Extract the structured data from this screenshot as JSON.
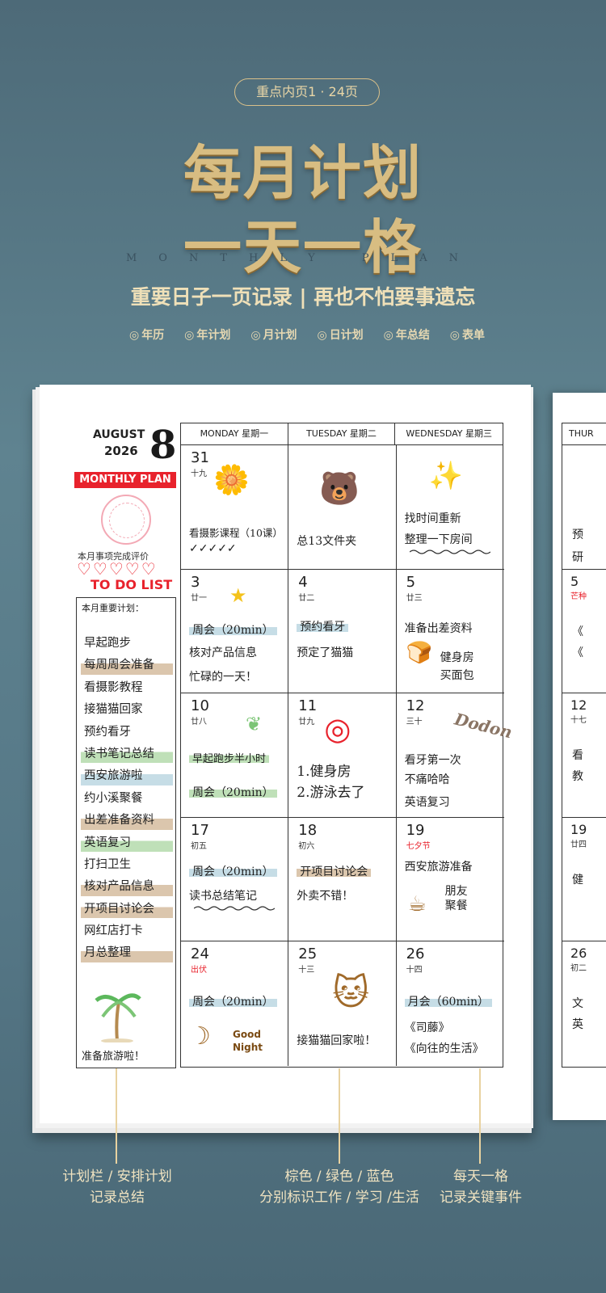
{
  "header": {
    "badge": "重点内页1 · 24页",
    "title_line1": "每月计划",
    "title_line2": "一天一格",
    "subtitle_en": "MONTHLY PLAN",
    "tagline": "重要日子一页记录 | 再也不怕要事遗忘",
    "features": [
      "年历",
      "年计划",
      "月计划",
      "日计划",
      "年总结",
      "表单"
    ]
  },
  "colors": {
    "accent_red": "#e8222c",
    "gold": "#d8bd82",
    "brown_highlight": "#dbc6ad",
    "green_highlight": "#bfe0b8",
    "blue_highlight": "#c6dde6"
  },
  "sidebar": {
    "month_name": "AUGUST",
    "year": "2026",
    "month_number": "8",
    "monthly_plan": "MONTHLY PLAN",
    "eval_label": "本月事项完成评价",
    "hearts": "♡♡♡♡♡",
    "todo": "TO DO LIST",
    "plan_title": "本月重要计划：",
    "plan_items": [
      {
        "text": "早起跑步",
        "hl": ""
      },
      {
        "text": "每周周会准备",
        "hl": "brown"
      },
      {
        "text": "看摄影教程",
        "hl": ""
      },
      {
        "text": "接猫猫回家",
        "hl": ""
      },
      {
        "text": "预约看牙",
        "hl": ""
      },
      {
        "text": "读书笔记总结",
        "hl": "green"
      },
      {
        "text": "西安旅游啦",
        "hl": "blue"
      },
      {
        "text": "约小溪聚餐",
        "hl": ""
      },
      {
        "text": "出差准备资料",
        "hl": "brown"
      },
      {
        "text": "英语复习",
        "hl": "green"
      },
      {
        "text": "打扫卫生",
        "hl": ""
      },
      {
        "text": "核对产品信息",
        "hl": "brown"
      },
      {
        "text": "开项目讨论会",
        "hl": "brown"
      },
      {
        "text": "网红店打卡",
        "hl": ""
      },
      {
        "text": "月总整理",
        "hl": "brown"
      }
    ],
    "plan_footer": "准备旅游啦！"
  },
  "calendar": {
    "headers": [
      "MONDAY  星期一",
      "TUESDAY  星期二",
      "WEDNESDAY  星期三"
    ],
    "rows": [
      [
        {
          "day": "31",
          "lunar": "十九",
          "notes": [
            "看摄影课程（10课）",
            "✓✓✓✓✓"
          ]
        },
        {
          "day": "",
          "lunar": "",
          "notes": [
            "总13文件夹"
          ]
        },
        {
          "day": "",
          "lunar": "",
          "notes": [
            "找时间重新",
            "整理一下房间"
          ]
        }
      ],
      [
        {
          "day": "3",
          "lunar": "廿一",
          "notes": [
            "周会（20min）",
            "核对产品信息",
            "忙碌的一天！"
          ]
        },
        {
          "day": "4",
          "lunar": "廿二",
          "notes": [
            "预约看牙",
            "预定了猫猫"
          ]
        },
        {
          "day": "5",
          "lunar": "廿三",
          "notes": [
            "准备出差资料",
            "健身房",
            "买面包"
          ]
        }
      ],
      [
        {
          "day": "10",
          "lunar": "廿八",
          "notes": [
            "早起跑步半小时",
            "周会（20min）"
          ]
        },
        {
          "day": "11",
          "lunar": "廿九",
          "notes": [
            "1.健身房",
            "2.游泳去了"
          ]
        },
        {
          "day": "12",
          "lunar": "三十",
          "notes": [
            "看牙第一次",
            "不痛哈哈",
            "英语复习"
          ]
        }
      ],
      [
        {
          "day": "17",
          "lunar": "初五",
          "notes": [
            "周会（20min）",
            "读书总结笔记"
          ]
        },
        {
          "day": "18",
          "lunar": "初六",
          "notes": [
            "开项目讨论会",
            "外卖不错！"
          ]
        },
        {
          "day": "19",
          "lunar": "七夕节",
          "notes": [
            "西安旅游准备",
            "朋友",
            "聚餐"
          ]
        }
      ],
      [
        {
          "day": "24",
          "lunar": "出伏",
          "notes": [
            "周会（20min）",
            "Good",
            "Night"
          ]
        },
        {
          "day": "25",
          "lunar": "十三",
          "notes": [
            "接猫猫回家啦！"
          ]
        },
        {
          "day": "26",
          "lunar": "十四",
          "notes": [
            "月会（60min）",
            "《司藤》",
            "《向往的生活》"
          ]
        }
      ]
    ],
    "sticker_text": "Dodon",
    "thursday": {
      "header": "THUR",
      "cells": [
        {
          "day": "",
          "lunar": "",
          "notes": [
            "预",
            "研"
          ]
        },
        {
          "day": "5",
          "lunar": "芒种",
          "notes": [
            "《",
            "《"
          ]
        },
        {
          "day": "12",
          "lunar": "十七",
          "notes": [
            "看",
            "教"
          ]
        },
        {
          "day": "19",
          "lunar": "廿四",
          "notes": [
            "健"
          ]
        },
        {
          "day": "26",
          "lunar": "初二",
          "notes": [
            "文",
            "英"
          ]
        }
      ]
    }
  },
  "captions": {
    "left": [
      "计划栏 / 安排计划",
      "记录总结"
    ],
    "middle": [
      "棕色 / 绿色 / 蓝色",
      "分别标识工作 / 学习 /生活"
    ],
    "right": [
      "每天一格",
      "记录关键事件"
    ]
  }
}
